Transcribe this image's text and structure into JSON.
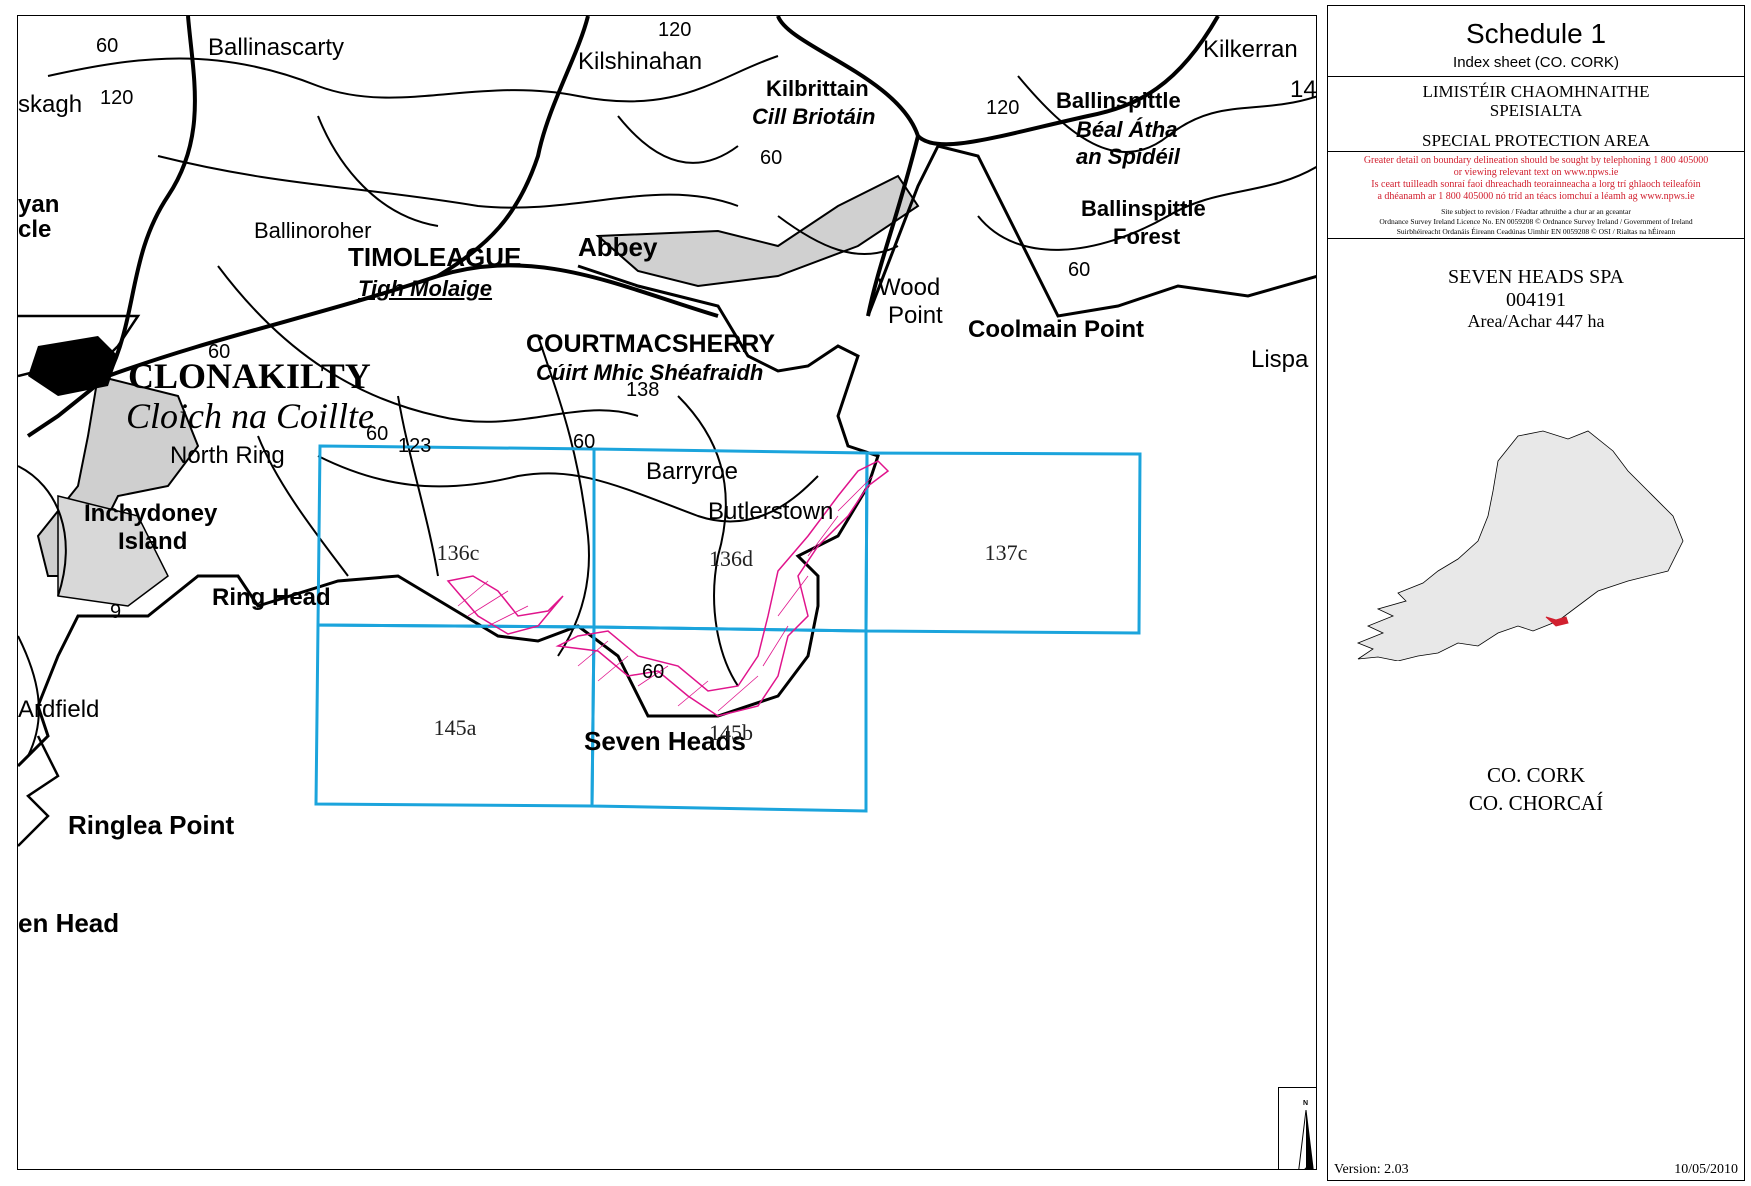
{
  "map": {
    "places": [
      {
        "id": "ballinascarty",
        "text": "Ballinascarty"
      },
      {
        "id": "kilshinahan",
        "text": "Kilshinahan"
      },
      {
        "id": "kilbrittain",
        "text": "Kilbrittain"
      },
      {
        "id": "cill-briotain",
        "text": "Cill Briotáin"
      },
      {
        "id": "kilkerran",
        "text": "Kilkerran"
      },
      {
        "id": "ballinspittle",
        "text": "Ballinspittle"
      },
      {
        "id": "beal-atha",
        "text": "Béal Átha"
      },
      {
        "id": "an-spideil",
        "text": "an Spidéil"
      },
      {
        "id": "ballinspittle-forest-1",
        "text": "Ballinspittle"
      },
      {
        "id": "ballinspittle-forest-2",
        "text": "Forest"
      },
      {
        "id": "skagh",
        "text": "skagh"
      },
      {
        "id": "yan",
        "text": "yan"
      },
      {
        "id": "cle",
        "text": "cle"
      },
      {
        "id": "ballinoroher",
        "text": "Ballinoroher"
      },
      {
        "id": "timoleague",
        "text": "TIMOLEAGUE"
      },
      {
        "id": "tigh-molaige",
        "text": "Tigh Molaige"
      },
      {
        "id": "abbey",
        "text": "Abbey"
      },
      {
        "id": "wood-point-1",
        "text": "Wood"
      },
      {
        "id": "wood-point-2",
        "text": "Point"
      },
      {
        "id": "coolmain-point",
        "text": "Coolmain Point"
      },
      {
        "id": "lispa",
        "text": "Lispa"
      },
      {
        "id": "courtmacsherry",
        "text": "COURTMACSHERRY"
      },
      {
        "id": "cuirt",
        "text": "Cúirt Mhic Shéafraidh"
      },
      {
        "id": "clonakilty",
        "text": "CLONAKILTY"
      },
      {
        "id": "cloich",
        "text": "Cloich na Coillte"
      },
      {
        "id": "north-ring",
        "text": "North Ring"
      },
      {
        "id": "inchydoney-1",
        "text": "Inchydoney"
      },
      {
        "id": "inchydoney-2",
        "text": "Island"
      },
      {
        "id": "barryroe",
        "text": "Barryroe"
      },
      {
        "id": "butlerstown",
        "text": "Butlerstown"
      },
      {
        "id": "ring-head",
        "text": "Ring Head"
      },
      {
        "id": "ardfield",
        "text": "Ardfield"
      },
      {
        "id": "seven-heads",
        "text": "Seven Heads"
      },
      {
        "id": "ringlea-point",
        "text": "Ringlea Point"
      },
      {
        "id": "en-head",
        "text": "en Head"
      }
    ],
    "contours": [
      "60",
      "120",
      "120",
      "14",
      "60",
      "120",
      "60",
      "60",
      "60",
      "60",
      "123",
      "138",
      "60",
      "9"
    ],
    "sheets": [
      "136c",
      "136d",
      "137c",
      "145a",
      "145b"
    ],
    "north_label": "N"
  },
  "panel": {
    "title": "Schedule 1",
    "subtitle": "Index sheet (CO. CORK)",
    "irish_title_1": "LIMISTÉIR CHAOMHNAITHE",
    "irish_title_2": "SPEISIALTA",
    "english_title": "SPECIAL PROTECTION AREA",
    "notice_lines": [
      "Greater detail on boundary delineation should be sought by telephoning 1 800 405000",
      "or viewing relevant text on www.npws.ie",
      "Is ceart tuilleadh sonraí faoi dhreachadh teorainneacha a lorg trí ghlaoch teileafóin",
      "a dhéanamh ar 1 800 405000 nó tríd an téacs iomchuí a léamh ag www.npws.ie"
    ],
    "fine_print": [
      "Site subject to revision / Féadtar athruithe a chur ar an gceantar",
      "Ordnance Survey Ireland Licence No. EN 0059208 © Ordnance Survey Ireland / Government of Ireland",
      "Suirbhéireacht Ordanáis Éireann Ceadúnas Uimhir EN 0059208 © OSI / Rialtas na hÉireann"
    ],
    "site_name": "SEVEN HEADS SPA",
    "site_code": "004191",
    "area": "Area/Achar 447 ha",
    "county_en": "CO. CORK",
    "county_ga": "CO. CHORCAÍ",
    "version": "Version: 2.03",
    "date": "10/05/2010",
    "colors": {
      "notice": "#d1202f",
      "grid": "#1ba4dc",
      "site": "#e0148c",
      "county_fill": "#e8e8e8",
      "site_marker": "#d1202f"
    }
  }
}
